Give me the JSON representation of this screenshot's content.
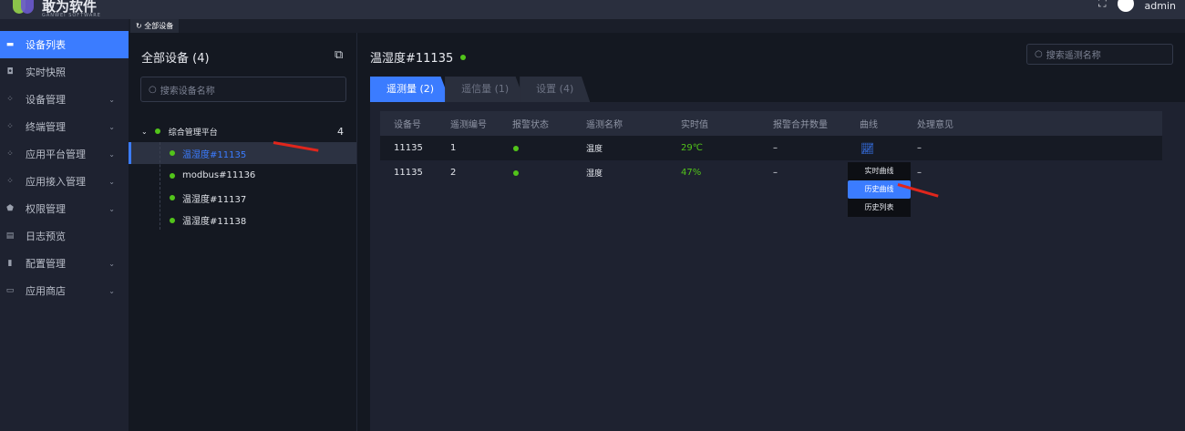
{
  "header": {
    "logo_text": "敢为软件",
    "logo_sub": "GANWEI SOFTWARE",
    "user": "admin"
  },
  "sidebar": {
    "items": [
      {
        "label": "设备列表",
        "icon": "monitor-icon",
        "active": true,
        "expandable": false
      },
      {
        "label": "实时快照",
        "icon": "camera-icon",
        "expandable": false
      },
      {
        "label": "设备管理",
        "icon": "grid-icon",
        "expandable": true
      },
      {
        "label": "终端管理",
        "icon": "grid-icon",
        "expandable": true
      },
      {
        "label": "应用平台管理",
        "icon": "grid-icon",
        "expandable": true
      },
      {
        "label": "应用接入管理",
        "icon": "grid-icon",
        "expandable": true
      },
      {
        "label": "权限管理",
        "icon": "shield-icon",
        "expandable": true
      },
      {
        "label": "日志预览",
        "icon": "document-icon",
        "expandable": false
      },
      {
        "label": "配置管理",
        "icon": "bookmark-icon",
        "expandable": true
      },
      {
        "label": "应用商店",
        "icon": "store-icon",
        "expandable": true
      }
    ]
  },
  "page_tab": {
    "label": "全部设备"
  },
  "left": {
    "title": "全部设备 (4)",
    "search_placeholder": "搜索设备名称",
    "tree": {
      "group": "综合管理平台",
      "count": "4",
      "devices": [
        "温湿度#11135",
        "modbus#11136",
        "温湿度#11137",
        "温湿度#11138"
      ],
      "selected": 0
    }
  },
  "right": {
    "device_title": "温湿度#11135",
    "search_placeholder": "搜索遥测名称",
    "tabs": [
      "遥测量 (2)",
      "遥信量 (1)",
      "设置 (4)"
    ],
    "columns": [
      "设备号",
      "遥测编号",
      "报警状态",
      "遥测名称",
      "实时值",
      "报警合并数量",
      "曲线",
      "处理意见"
    ],
    "rows": [
      {
        "device": "11135",
        "no": "1",
        "name": "温度",
        "value": "29℃",
        "merge": "–",
        "opinion": "–"
      },
      {
        "device": "11135",
        "no": "2",
        "name": "湿度",
        "value": "47%",
        "merge": "–",
        "opinion": "–"
      }
    ],
    "curve_menu": [
      "实时曲线",
      "历史曲线",
      "历史列表"
    ]
  },
  "colors": {
    "accent": "#3b7cff",
    "ok": "#52c41a",
    "annotation": "#e0261c"
  }
}
